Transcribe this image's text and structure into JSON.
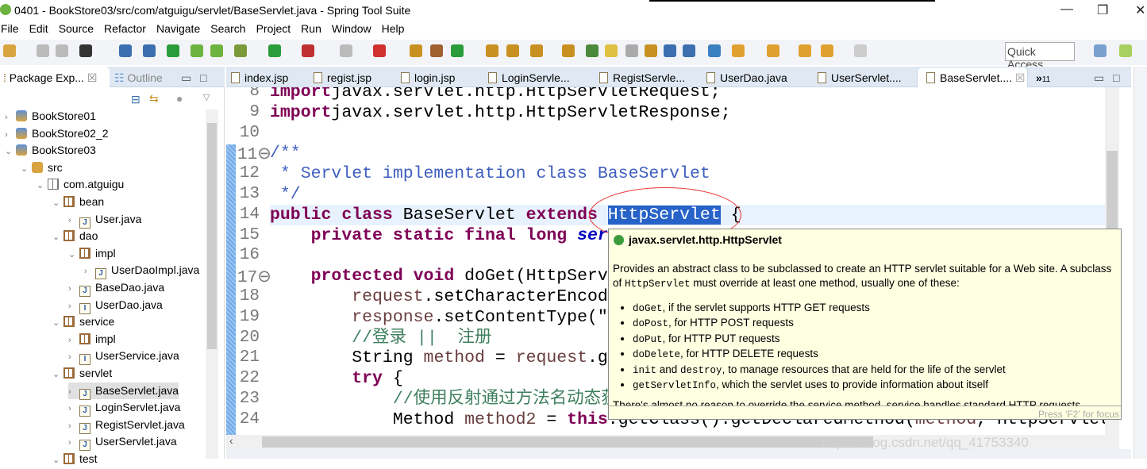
{
  "window": {
    "title": "0401 - BookStore03/src/com/atguigu/servlet/BaseServlet.java - Spring Tool Suite",
    "minimize": "—",
    "restore": "❐",
    "close": "✕"
  },
  "menu": [
    "File",
    "Edit",
    "Source",
    "Refactor",
    "Navigate",
    "Search",
    "Project",
    "Run",
    "Window",
    "Help"
  ],
  "toolbar": {
    "quick_access": "Quick Access"
  },
  "left_panel": {
    "tabs": [
      {
        "label": "Package Exp...",
        "close": "☒"
      },
      {
        "label": "Outline"
      }
    ],
    "tree": [
      {
        "label": "BookStore01",
        "level": 0,
        "icon": "project-icon",
        "expanded": false
      },
      {
        "label": "BookStore02_2",
        "level": 0,
        "icon": "project-icon",
        "expanded": false
      },
      {
        "label": "BookStore03",
        "level": 0,
        "icon": "project-icon",
        "expanded": true
      },
      {
        "label": "src",
        "level": 1,
        "icon": "source-folder-icon",
        "expanded": true
      },
      {
        "label": "com.atguigu",
        "level": 2,
        "icon": "package-empty-icon",
        "expanded": true
      },
      {
        "label": "bean",
        "level": 3,
        "icon": "package-icon",
        "expanded": true
      },
      {
        "label": "User.java",
        "level": 4,
        "icon": "java-file-icon",
        "expanded": false
      },
      {
        "label": "dao",
        "level": 3,
        "icon": "package-icon",
        "expanded": true
      },
      {
        "label": "impl",
        "level": 4,
        "icon": "package-icon",
        "expanded": true
      },
      {
        "label": "UserDaoImpl.java",
        "level": 5,
        "icon": "java-file-icon",
        "expanded": false
      },
      {
        "label": "BaseDao.java",
        "level": 4,
        "icon": "java-file-icon",
        "expanded": false
      },
      {
        "label": "UserDao.java",
        "level": 4,
        "icon": "java-interface-icon",
        "expanded": false
      },
      {
        "label": "service",
        "level": 3,
        "icon": "package-icon",
        "expanded": true
      },
      {
        "label": "impl",
        "level": 4,
        "icon": "package-icon",
        "expanded": false
      },
      {
        "label": "UserService.java",
        "level": 4,
        "icon": "java-interface-icon",
        "expanded": false
      },
      {
        "label": "servlet",
        "level": 3,
        "icon": "package-icon",
        "expanded": true
      },
      {
        "label": "BaseServlet.java",
        "level": 4,
        "icon": "java-file-icon",
        "expanded": false,
        "selected": true
      },
      {
        "label": "LoginServlet.java",
        "level": 4,
        "icon": "java-file-icon",
        "expanded": false
      },
      {
        "label": "RegistServlet.java",
        "level": 4,
        "icon": "java-file-icon",
        "expanded": false
      },
      {
        "label": "UserServlet.java",
        "level": 4,
        "icon": "java-file-icon",
        "expanded": false
      },
      {
        "label": "test",
        "level": 3,
        "icon": "package-icon",
        "expanded": true
      }
    ]
  },
  "editor": {
    "tabs": [
      "index.jsp",
      "regist.jsp",
      "login.jsp",
      "LoginServle...",
      "RegistServle...",
      "UserDao.java",
      "UserServlet....",
      "BaseServlet...."
    ],
    "active_tab": "BaseServlet....",
    "overflow": "»",
    "overflow_count": "11",
    "lines": [
      {
        "n": "8",
        "t": [
          [
            "kw",
            "import"
          ],
          [
            "",
            "javax.servlet.http.HttpServletRequest;"
          ]
        ]
      },
      {
        "n": "9",
        "t": [
          [
            "kw",
            "import"
          ],
          [
            "",
            "javax.servlet.http.HttpServletResponse;"
          ]
        ]
      },
      {
        "n": "10",
        "t": []
      },
      {
        "n": "11⊖",
        "t": [
          [
            "cm",
            "/**"
          ]
        ]
      },
      {
        "n": "12",
        "t": [
          [
            "cm",
            " * Servlet implementation class BaseServlet"
          ]
        ]
      },
      {
        "n": "13",
        "t": [
          [
            "cm",
            " */"
          ]
        ]
      },
      {
        "n": "14",
        "t": [
          [
            "kw",
            "public class"
          ],
          [
            "",
            " BaseServlet "
          ],
          [
            "kw",
            "extends"
          ],
          [
            "",
            " "
          ],
          [
            "hl",
            "HttpServlet"
          ],
          [
            "",
            " {"
          ]
        ]
      },
      {
        "n": "15",
        "t": [
          [
            "",
            "    "
          ],
          [
            "kw",
            "private static final long"
          ],
          [
            "",
            " "
          ],
          [
            "fld",
            "ser"
          ]
        ]
      },
      {
        "n": "16",
        "t": []
      },
      {
        "n": "17⊖",
        "t": [
          [
            "",
            "    "
          ],
          [
            "kw",
            "protected void"
          ],
          [
            "",
            " doGet(HttpServ"
          ]
        ]
      },
      {
        "n": "18",
        "t": [
          [
            "",
            "        "
          ],
          [
            "var",
            "request"
          ],
          [
            "",
            ".setCharacterEncod"
          ]
        ]
      },
      {
        "n": "19",
        "t": [
          [
            "",
            "        "
          ],
          [
            "var",
            "response"
          ],
          [
            "",
            ".setContentType(\""
          ]
        ]
      },
      {
        "n": "20",
        "t": [
          [
            "",
            "        "
          ],
          [
            "lc",
            "//登录 ||  注册"
          ]
        ]
      },
      {
        "n": "21",
        "t": [
          [
            "",
            "        String "
          ],
          [
            "var",
            "method"
          ],
          [
            "",
            " = "
          ],
          [
            "var",
            "request"
          ],
          [
            "",
            ".g"
          ]
        ]
      },
      {
        "n": "22",
        "t": [
          [
            "",
            "        "
          ],
          [
            "kw",
            "try"
          ],
          [
            "",
            " {"
          ]
        ]
      },
      {
        "n": "23",
        "t": [
          [
            "",
            "            "
          ],
          [
            "lc",
            "//使用反射通过方法名动态获取方法"
          ]
        ]
      },
      {
        "n": "24",
        "t": [
          [
            "",
            "            Method "
          ],
          [
            "var",
            "method2"
          ],
          [
            "",
            " = "
          ],
          [
            "kw",
            "this"
          ],
          [
            "",
            ".getClass().getDeclaredMethod("
          ],
          [
            "var",
            "method"
          ],
          [
            "",
            ", HttpServlet"
          ]
        ]
      }
    ]
  },
  "tooltip": {
    "title": "javax.servlet.http.HttpServlet",
    "p1a": "Provides an abstract class to be subclassed to create an HTTP servlet suitable for a Web site. A subclass of ",
    "p1code": "HttpServlet",
    "p1b": " must override at least one method, usually one of these:",
    "items": [
      {
        "code": "doGet",
        "text": ", if the servlet supports HTTP GET requests"
      },
      {
        "code": "doPost",
        "text": ", for HTTP POST requests"
      },
      {
        "code": "doPut",
        "text": ", for HTTP PUT requests"
      },
      {
        "code": "doDelete",
        "text": ", for HTTP DELETE requests"
      },
      {
        "code": "init",
        "text": " and ",
        "code2": "destroy",
        "text2": ", to manage resources that are held for the life of the servlet"
      },
      {
        "code": "getServletInfo",
        "text": ", which the servlet uses to provide information about itself"
      }
    ],
    "cut_line": "There's almost no reason to override the service method. service handles standard HTTP requests",
    "footer": "Press 'F2' for focus"
  },
  "watermark": "https://blog.csdn.net/qq_41753340",
  "colors": {
    "keyword": "#7f0055",
    "javadoc": "#3f5fbf",
    "comment": "#3f7f5f",
    "selection": "#2662c8",
    "tooltip_bg": "#ffffe1",
    "annotation_ellipse": "#e33333"
  }
}
